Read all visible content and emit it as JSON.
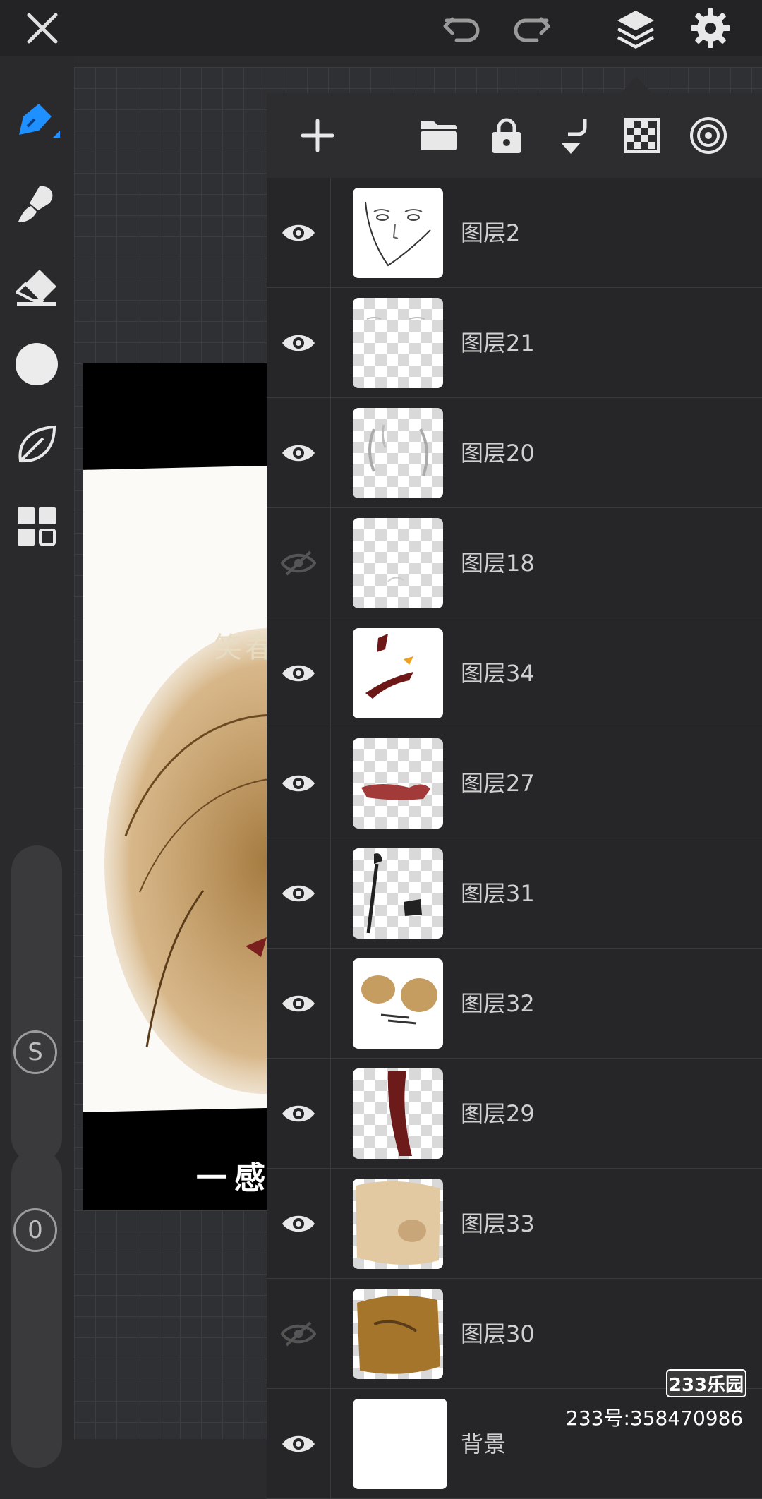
{
  "toolbar": {
    "close": "close-icon",
    "undo": "undo-icon",
    "redo": "redo-icon",
    "layers": "layers-icon",
    "settings": "gear-icon"
  },
  "sidebar": {
    "tools": [
      "pen-icon",
      "brush-icon",
      "eraser-icon",
      "color-circle-icon",
      "leaf-icon",
      "grid-icon"
    ],
    "size_slider_label": "S",
    "opacity_slider_label": "0"
  },
  "artwork": {
    "caption": "一感",
    "faint_text": "笑春"
  },
  "layers_panel": {
    "toolbar_icons": [
      "add-icon",
      "folder-icon",
      "lock-icon",
      "merge-down-icon",
      "transparency-icon",
      "target-icon"
    ],
    "layers": [
      {
        "name": "图层2",
        "visible": true
      },
      {
        "name": "图层21",
        "visible": true
      },
      {
        "name": "图层20",
        "visible": true
      },
      {
        "name": "图层18",
        "visible": false
      },
      {
        "name": "图层34",
        "visible": true
      },
      {
        "name": "图层27",
        "visible": true
      },
      {
        "name": "图层31",
        "visible": true
      },
      {
        "name": "图层32",
        "visible": true
      },
      {
        "name": "图层29",
        "visible": true
      },
      {
        "name": "图层33",
        "visible": true
      },
      {
        "name": "图层30",
        "visible": false
      },
      {
        "name": "背景",
        "visible": true
      }
    ]
  },
  "watermark": {
    "logo": "233乐园",
    "id": "233号:358470986"
  }
}
